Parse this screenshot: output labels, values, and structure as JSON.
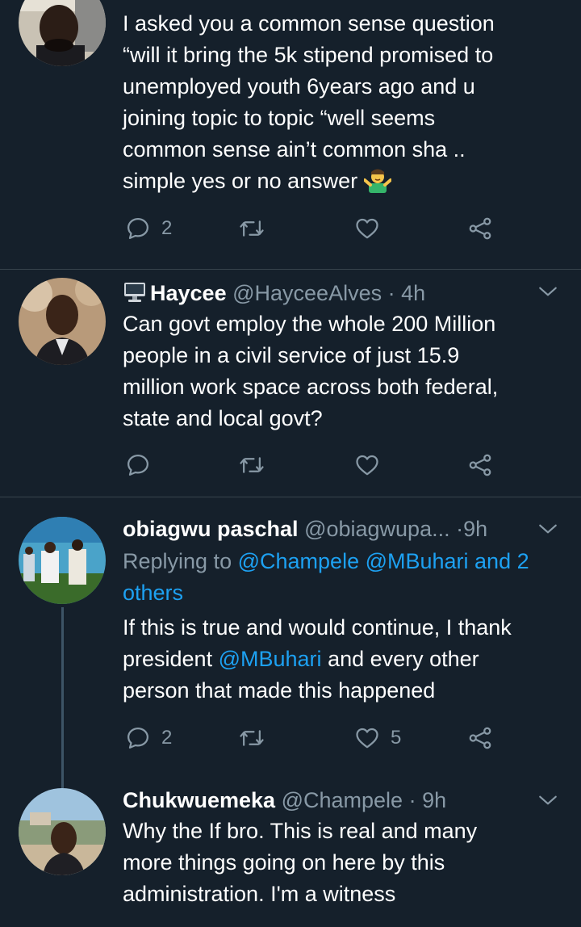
{
  "tweets": [
    {
      "body_lines": [
        "I asked you a common sense question",
        "“will it bring the 5k stipend promised to",
        "unemployed youth 6years ago and u",
        "joining topic to topic “well seems",
        "common sense ain’t common sha ..",
        "simple yes or no answer"
      ],
      "emoji": "man-shrugging-emoji",
      "reply_count": "2",
      "like_count": ""
    },
    {
      "display_name": "Haycee",
      "name_icon": "desktop-computer-emoji",
      "handle": "@HayceeAlves",
      "separator": "·",
      "time": "4h",
      "body_lines": [
        "Can govt employ the whole 200 Million",
        "people in a civil service of just 15.9",
        "million work space across both federal,",
        "state and local govt?"
      ],
      "reply_count": "",
      "like_count": ""
    },
    {
      "display_name": "obiagwu paschal",
      "handle": "@obiagwupa...",
      "separator": "·",
      "time": "9h",
      "replying_prefix": "Replying to",
      "replying_links": "@Champele @MBuhari and 2",
      "replying_links_2": "others",
      "body_line_1": "If this is true and would continue, I thank",
      "body_line_2_pre": "president",
      "body_line_2_mention": "@MBuhari",
      "body_line_2_post": "and every other",
      "body_line_3": "person that made this happened",
      "reply_count": "2",
      "like_count": "5"
    },
    {
      "display_name": "Chukwuemeka",
      "handle": "@Champele",
      "separator": "·",
      "time": "9h",
      "body_lines": [
        "Why the If bro. This is real and many",
        "more things going on here by this",
        "administration. I'm a witness"
      ]
    }
  ],
  "colors": {
    "background": "#15202b",
    "divider": "#38444d",
    "secondary_text": "#8899a6",
    "link": "#1da1f2",
    "primary_text": "#ffffff"
  }
}
